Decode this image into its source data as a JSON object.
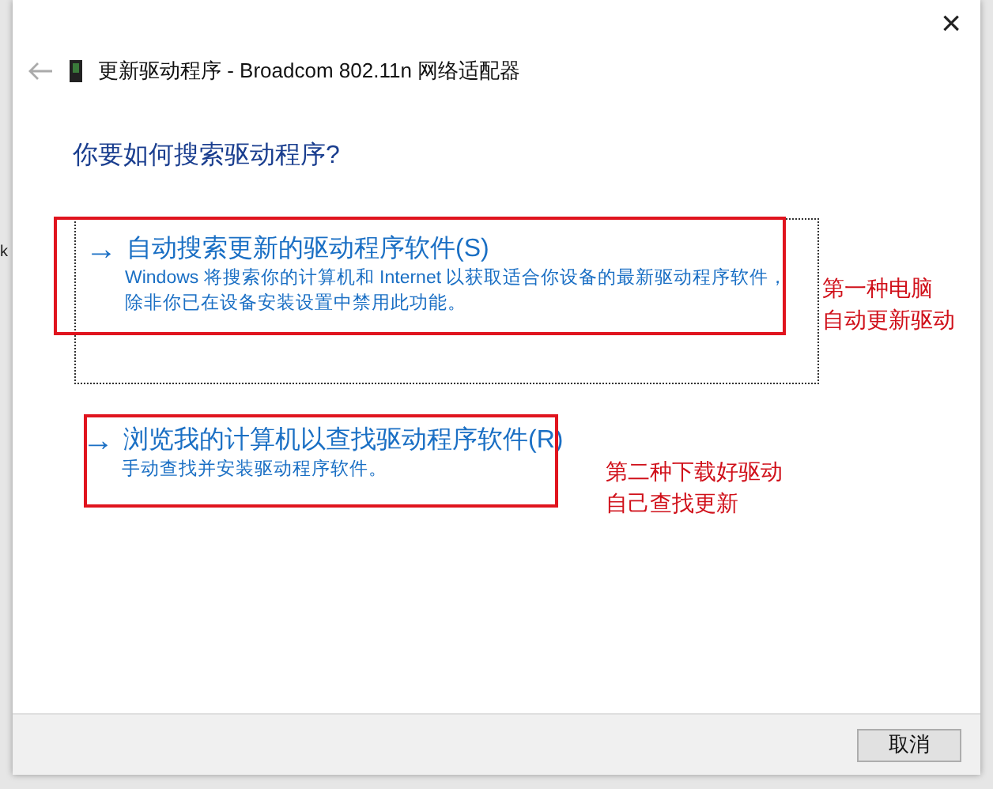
{
  "background_fragment": "k",
  "window": {
    "title": "更新驱动程序 - Broadcom 802.11n 网络适配器",
    "close": "×"
  },
  "heading": "你要如何搜索驱动程序?",
  "options": [
    {
      "arrow": "→",
      "title": "自动搜索更新的驱动程序软件(S)",
      "description": "Windows 将搜索你的计算机和 Internet 以获取适合你设备的最新驱动程序软件，除非你已在设备安装设置中禁用此功能。",
      "focused": true
    },
    {
      "arrow": "→",
      "title": "浏览我的计算机以查找驱动程序软件(R)",
      "description": "手动查找并安装驱动程序软件。",
      "focused": false
    }
  ],
  "annotations": [
    {
      "lines": [
        "第一种电脑",
        "自动更新驱动"
      ]
    },
    {
      "lines": [
        "第二种下载好驱动",
        "自己查找更新"
      ]
    }
  ],
  "buttons": [
    "取消"
  ]
}
